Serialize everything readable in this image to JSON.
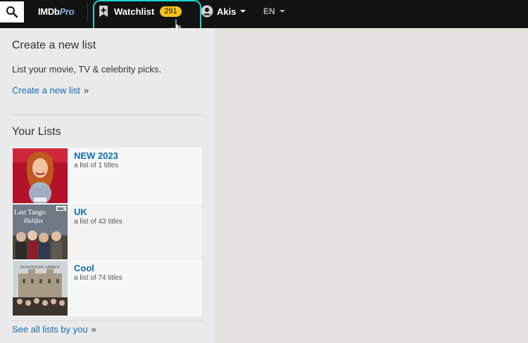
{
  "header": {
    "logo_main": "IMDb",
    "logo_pro": "Pro",
    "watchlist_label": "Watchlist",
    "watchlist_count": "291",
    "user_name": "Akis",
    "language": "EN"
  },
  "create": {
    "title": "Create a new list",
    "description": "List your movie, TV & celebrity picks.",
    "link": "Create a new list",
    "arrow": "»"
  },
  "lists": {
    "title": "Your Lists",
    "items": [
      {
        "name": "NEW 2023",
        "meta": "a list of 1 titles"
      },
      {
        "name": "UK",
        "meta": "a list of 43 titles"
      },
      {
        "name": "Cool",
        "meta": "a list of 74 titles"
      }
    ],
    "see_all": "See all lists by you",
    "arrow": "»"
  },
  "thumb_texts": {
    "uk_title": "Last Tango",
    "uk_subtitle": "Halifax",
    "uk_badge": "BBC",
    "cool_title": "DOWNTON ABBEY"
  },
  "colors": {
    "topbar": "#121212",
    "accent": "#f5c518",
    "link": "#136cb2",
    "highlight": "#1ad5d0"
  }
}
